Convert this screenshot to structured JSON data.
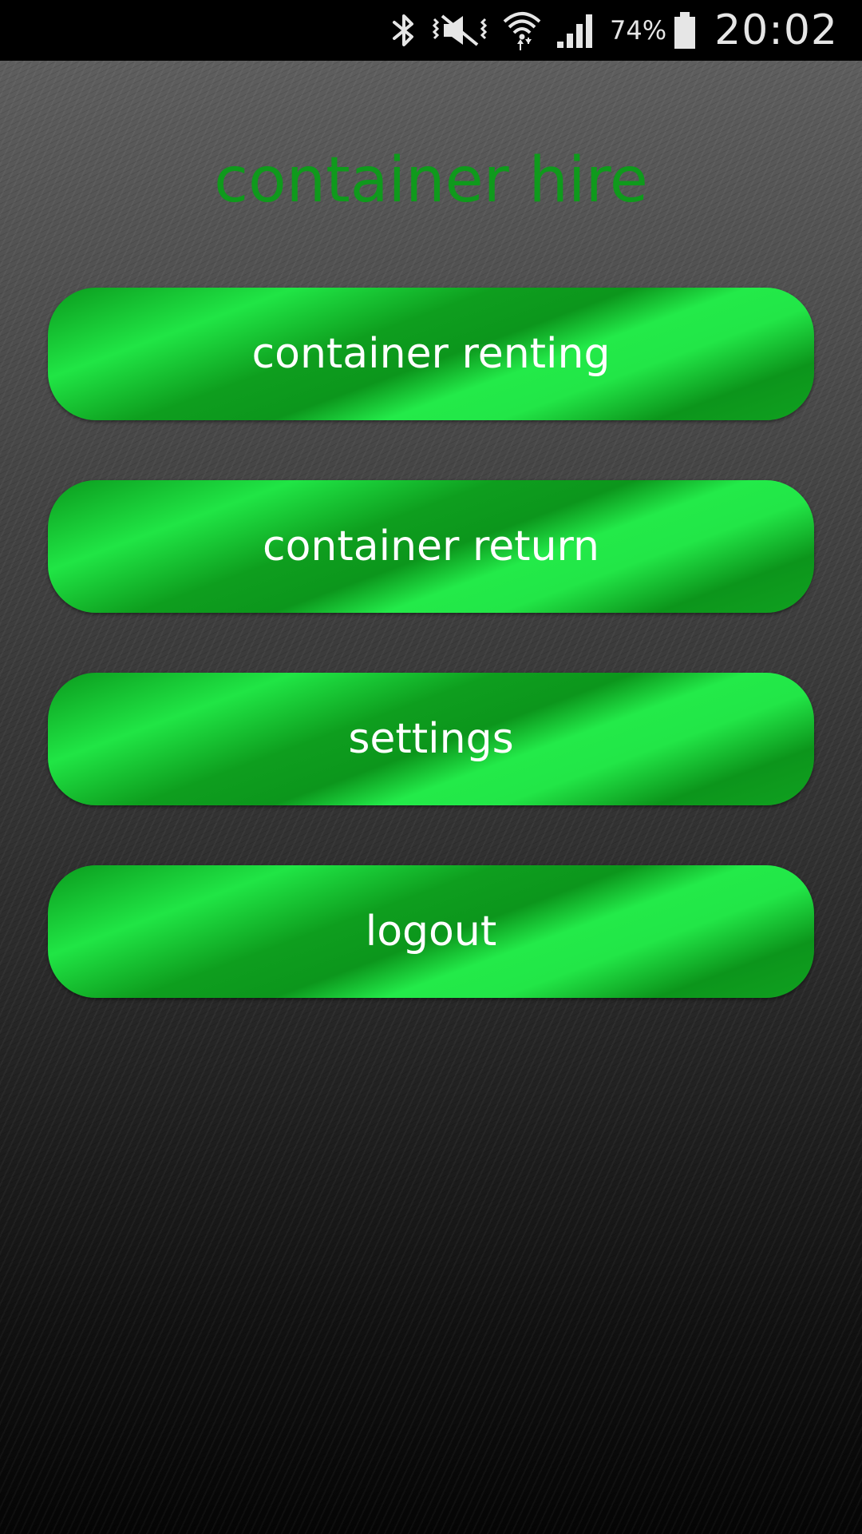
{
  "status_bar": {
    "battery_percent": "74%",
    "time": "20:02",
    "icons": [
      "bluetooth-icon",
      "vibrate-icon",
      "wifi-icon",
      "signal-icon",
      "battery-icon"
    ]
  },
  "app": {
    "title": "container hire"
  },
  "menu": {
    "items": [
      {
        "label": "container renting"
      },
      {
        "label": "container return"
      },
      {
        "label": "settings"
      },
      {
        "label": "logout"
      }
    ]
  },
  "colors": {
    "title": "#0f9a1c",
    "button_dark": "#0c961c",
    "button_light": "#22e647",
    "button_text": "#ffffff",
    "status_bar": "#000000"
  }
}
